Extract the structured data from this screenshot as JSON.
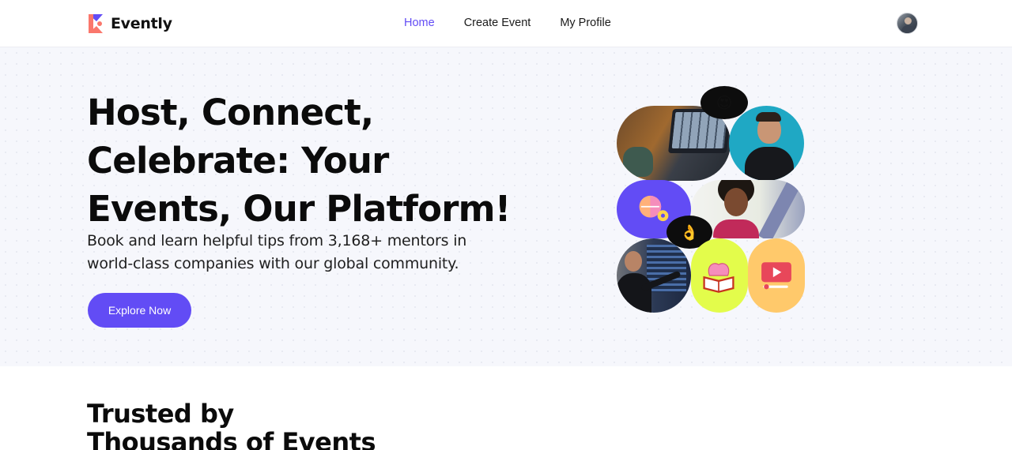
{
  "brand": {
    "name": "Evently",
    "accent": "#624CF5"
  },
  "nav": {
    "items": [
      {
        "label": "Home",
        "active": true
      },
      {
        "label": "Create Event",
        "active": false
      },
      {
        "label": "My Profile",
        "active": false
      }
    ]
  },
  "user": {
    "avatar_icon": "user-avatar"
  },
  "hero": {
    "title_lines": [
      "Host, Connect,",
      "Celebrate: Your",
      "Events, Our Platform!"
    ],
    "subtitle_lines": [
      "Book and learn helpful tips from 3,168+ mentors in",
      "world-class companies with our global community."
    ],
    "cta_label": "Explore Now"
  },
  "collage": {
    "emoji_top": "😍",
    "emoji_mid": "👌",
    "icons": [
      "brain-gear-icon",
      "brain-book-icon",
      "video-play-icon"
    ]
  },
  "trusted": {
    "title_lines": [
      "Trusted by",
      "Thousands of Events"
    ]
  }
}
